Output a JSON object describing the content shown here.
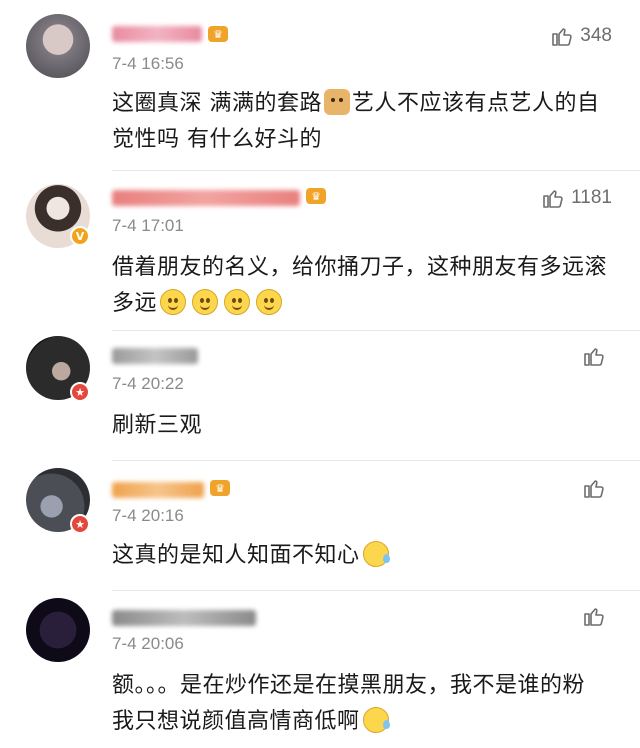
{
  "comments": [
    {
      "time": "7-4 16:56",
      "likes": "348",
      "text_lines": [
        "这圈真深 满满的套路",
        "艺人不应该有点艺人的自",
        "觉性吗  有什么好斗的"
      ],
      "avatar_color": "#8f8a90",
      "name_color": "#e98aa0"
    },
    {
      "time": "7-4 17:01",
      "likes": "1181",
      "text_lines": [
        "借着朋友的名义，给你捅刀子，这种朋友有多远滚",
        "多远"
      ],
      "avatar_color": "#c6b7ad",
      "name_color": "#e8807f"
    },
    {
      "time": "7-4 20:22",
      "likes": "",
      "text_lines": [
        "刷新三观"
      ],
      "avatar_color": "#2b2b2b",
      "name_color": "#9a9a9a"
    },
    {
      "time": "7-4 20:16",
      "likes": "",
      "text_lines": [
        "这真的是知人知面不知心"
      ],
      "avatar_color": "#4b4e55",
      "name_color": "#f0a24c"
    },
    {
      "time": "7-4 20:06",
      "likes": "",
      "text_lines": [
        "额。。。是在炒作还是在摸黑朋友，我不是谁的粉",
        "我只想说颜值高情商低啊"
      ],
      "avatar_color": "#0f0a18",
      "name_color": "#8a8a8a"
    }
  ],
  "icons": {
    "like": "thumbs-up-icon",
    "emoji_smile": "smile-emoji-icon",
    "emoji_doge": "doge-emoji-icon",
    "emoji_sweat": "sweat-emoji-icon",
    "vip": "vip-crown-icon"
  },
  "colors": {
    "text": "#1a1a1a",
    "meta": "#8a8a8a",
    "badge_orange": "#f2a31b",
    "badge_red": "#e5483b"
  }
}
